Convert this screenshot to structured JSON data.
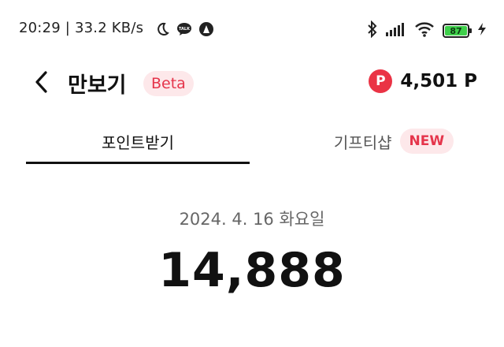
{
  "status_bar": {
    "time_speed": "20:29 | 33.2 KB/s",
    "battery": "87",
    "icons": [
      "moon-icon",
      "kakaotalk-icon",
      "app-icon",
      "bluetooth-icon",
      "signal-icon",
      "wifi-icon",
      "battery-icon",
      "charging-icon"
    ]
  },
  "header": {
    "title": "만보기",
    "beta_badge": "Beta",
    "points_icon_letter": "P",
    "points_value": "4,501 P"
  },
  "tabs": [
    {
      "label": "포인트받기",
      "active": true
    },
    {
      "label": "기프티샵",
      "badge": "NEW",
      "active": false
    }
  ],
  "main": {
    "date": "2024. 4. 16 화요일",
    "steps": "14,888"
  },
  "colors": {
    "accent_red": "#ea3345",
    "badge_bg": "#fde8ea",
    "badge_text": "#e5354b",
    "battery_green": "#3ecf4a"
  }
}
